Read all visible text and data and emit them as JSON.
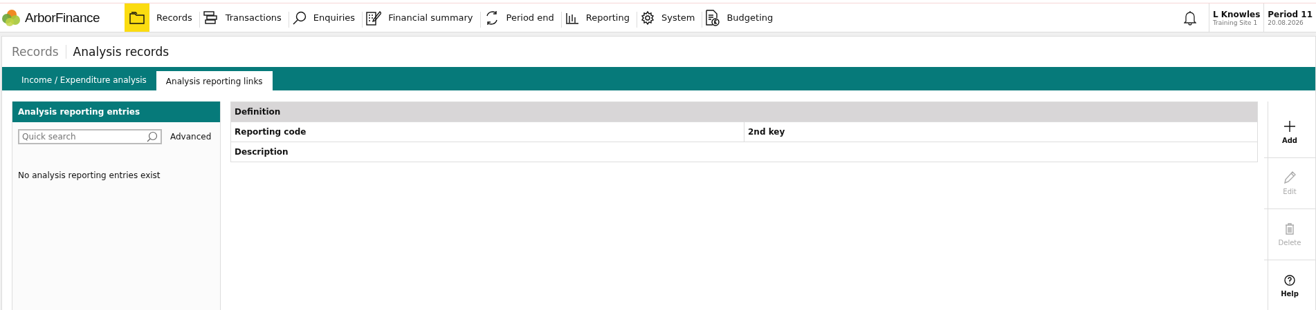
{
  "app": {
    "name": "ArborFinance"
  },
  "nav": [
    {
      "label": "Records",
      "kind": "folder",
      "selected": true
    },
    {
      "label": "Transactions",
      "kind": "stack",
      "selected": false
    },
    {
      "label": "Enquiries",
      "kind": "search",
      "selected": false
    },
    {
      "label": "Financial summary",
      "kind": "calc",
      "selected": false
    },
    {
      "label": "Period end",
      "kind": "cycle",
      "selected": false
    },
    {
      "label": "Reporting",
      "kind": "bars",
      "selected": false
    },
    {
      "label": "System",
      "kind": "gear",
      "selected": false
    },
    {
      "label": "Budgeting",
      "kind": "doc",
      "selected": false
    }
  ],
  "user": {
    "name": "L Knowles",
    "site": "Training Site 1"
  },
  "period": {
    "label": "Period 11",
    "date": "20.08.2026"
  },
  "breadcrumb": [
    "Records",
    "Analysis records"
  ],
  "tabs": [
    {
      "label": "Income / Expenditure analysis",
      "selected": false
    },
    {
      "label": "Analysis reporting links",
      "selected": true
    }
  ],
  "list_panel": {
    "title": "Analysis reporting entries",
    "search": {
      "placeholder": "Quick search"
    },
    "advanced": "Advanced",
    "empty_message": "No analysis reporting entries exist"
  },
  "definition": {
    "title": "Definition",
    "rows": [
      [
        "Reporting code",
        "2nd key"
      ],
      [
        "Description"
      ]
    ]
  },
  "actions": [
    {
      "label": "Add",
      "kind": "plus",
      "disabled": false
    },
    {
      "label": "Edit",
      "kind": "pencil",
      "disabled": true
    },
    {
      "label": "Delete",
      "kind": "bin",
      "disabled": true
    },
    {
      "label": "Help",
      "kind": "help",
      "disabled": false
    }
  ]
}
